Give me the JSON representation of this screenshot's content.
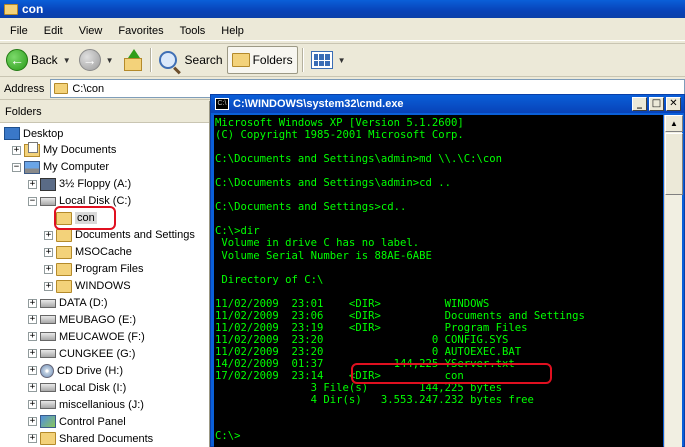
{
  "explorer": {
    "title": "con",
    "menu": [
      "File",
      "Edit",
      "View",
      "Favorites",
      "Tools",
      "Help"
    ],
    "toolbar": {
      "back": "Back",
      "search": "Search",
      "folders": "Folders"
    },
    "address_label": "Address",
    "address_value": "C:\\con",
    "folders_header": "Folders",
    "tree": [
      {
        "label": "Desktop",
        "icon": "desktop-icon",
        "indent": 0,
        "expander": ""
      },
      {
        "label": "My Documents",
        "icon": "my-documents-icon",
        "indent": 1,
        "expander": "+"
      },
      {
        "label": "My Computer",
        "icon": "my-computer-icon",
        "indent": 1,
        "expander": "−"
      },
      {
        "label": "3½ Floppy (A:)",
        "icon": "floppy-icon",
        "indent": 2,
        "expander": "+"
      },
      {
        "label": "Local Disk (C:)",
        "icon": "drive-icon",
        "indent": 2,
        "expander": "−"
      },
      {
        "label": "con",
        "icon": "folder-icon",
        "indent": 3,
        "expander": "",
        "selected": true
      },
      {
        "label": "Documents and Settings",
        "icon": "folder-icon",
        "indent": 3,
        "expander": "+"
      },
      {
        "label": "MSOCache",
        "icon": "folder-icon",
        "indent": 3,
        "expander": "+"
      },
      {
        "label": "Program Files",
        "icon": "folder-icon",
        "indent": 3,
        "expander": "+"
      },
      {
        "label": "WINDOWS",
        "icon": "folder-icon",
        "indent": 3,
        "expander": "+"
      },
      {
        "label": "DATA (D:)",
        "icon": "drive-icon",
        "indent": 2,
        "expander": "+"
      },
      {
        "label": "MEUBAGO (E:)",
        "icon": "drive-icon",
        "indent": 2,
        "expander": "+"
      },
      {
        "label": "MEUCAWOE (F:)",
        "icon": "drive-icon",
        "indent": 2,
        "expander": "+"
      },
      {
        "label": "CUNGKEE (G:)",
        "icon": "drive-icon",
        "indent": 2,
        "expander": "+"
      },
      {
        "label": "CD Drive (H:)",
        "icon": "cd-drive-icon",
        "indent": 2,
        "expander": "+"
      },
      {
        "label": "Local Disk (I:)",
        "icon": "drive-icon",
        "indent": 2,
        "expander": "+"
      },
      {
        "label": "miscellanious (J:)",
        "icon": "drive-icon",
        "indent": 2,
        "expander": "+"
      },
      {
        "label": "Control Panel",
        "icon": "control-panel-icon",
        "indent": 2,
        "expander": "+"
      },
      {
        "label": "Shared Documents",
        "icon": "folder-icon",
        "indent": 2,
        "expander": "+"
      }
    ]
  },
  "cmd": {
    "title": "C:\\WINDOWS\\system32\\cmd.exe",
    "lines": [
      "Microsoft Windows XP [Version 5.1.2600]",
      "(C) Copyright 1985-2001 Microsoft Corp.",
      "",
      "C:\\Documents and Settings\\admin>md \\\\.\\C:\\con",
      "",
      "C:\\Documents and Settings\\admin>cd ..",
      "",
      "C:\\Documents and Settings>cd..",
      "",
      "C:\\>dir",
      " Volume in drive C has no label.",
      " Volume Serial Number is 88AE-6ABE",
      "",
      " Directory of C:\\",
      "",
      "11/02/2009  23:01    <DIR>          WINDOWS",
      "11/02/2009  23:06    <DIR>          Documents and Settings",
      "11/02/2009  23:19    <DIR>          Program Files",
      "11/02/2009  23:20                 0 CONFIG.SYS",
      "11/02/2009  23:20                 0 AUTOEXEC.BAT",
      "14/02/2009  01:37           144,225 YServer.txt",
      "17/02/2009  23:14    <DIR>          con",
      "               3 File(s)        144,225 bytes",
      "               4 Dir(s)   3.553.247.232 bytes free",
      "",
      "",
      "C:\\>"
    ]
  }
}
